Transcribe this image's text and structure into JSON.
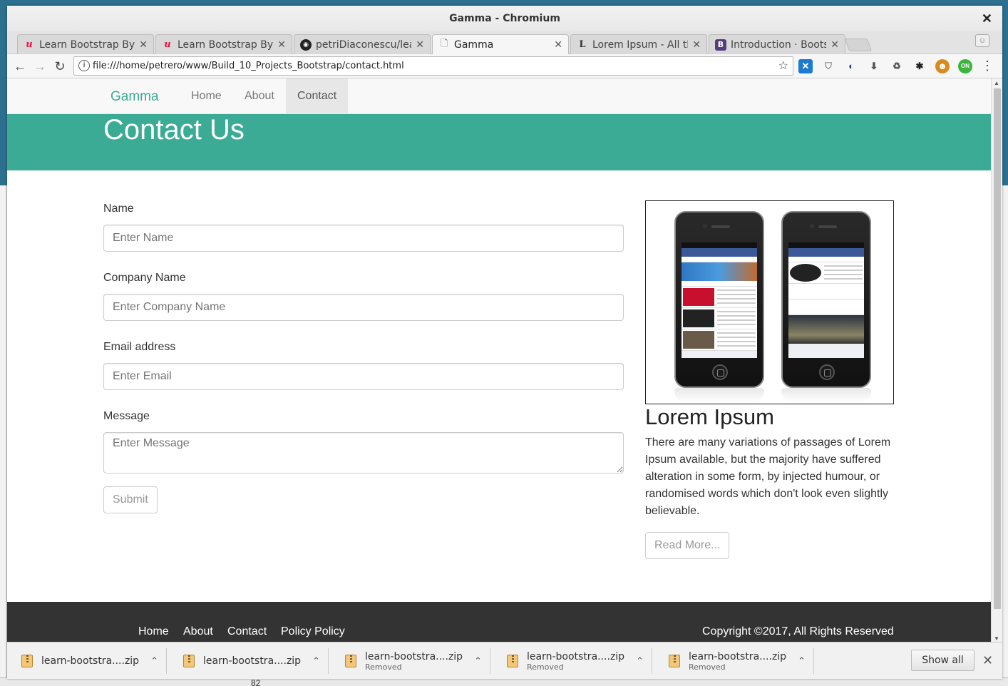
{
  "window": {
    "title": "Gamma - Chromium",
    "close_glyph": "✕"
  },
  "tabs": [
    {
      "label": "Learn Bootstrap By",
      "favicon": "udemy-icon",
      "active": false
    },
    {
      "label": "Learn Bootstrap By",
      "favicon": "udemy-icon",
      "active": false
    },
    {
      "label": "petriDiaconescu/lea",
      "favicon": "github-icon",
      "active": false
    },
    {
      "label": "Gamma",
      "favicon": "page-icon",
      "active": true
    },
    {
      "label": "Lorem Ipsum - All th",
      "favicon": "lipsum-icon",
      "active": false
    },
    {
      "label": "Introduction · Boots",
      "favicon": "bootstrap-icon",
      "active": false
    }
  ],
  "toolbar": {
    "url": "file:///home/petrero/www/Build_10_Projects_Bootstrap/contact.html"
  },
  "site": {
    "brand": "Gamma",
    "nav": [
      "Home",
      "About",
      "Contact"
    ],
    "active_nav": "Contact",
    "hero_title": "Contact Us",
    "accent_color": "#3bab95"
  },
  "form": {
    "name_label": "Name",
    "name_placeholder": "Enter Name",
    "company_label": "Company Name",
    "company_placeholder": "Enter Company Name",
    "email_label": "Email address",
    "email_placeholder": "Enter Email",
    "message_label": "Message",
    "message_placeholder": "Enter Message",
    "submit_label": "Submit"
  },
  "aside": {
    "heading": "Lorem Ipsum",
    "body": "There are many variations of passages of Lorem Ipsum available, but the majority have suffered alteration in some form, by injected humour, or randomised words which don't look even slightly believable.",
    "button_label": "Read More..."
  },
  "footer": {
    "links": [
      "Home",
      "About",
      "Contact",
      "Policy Policy"
    ],
    "copyright": "Copyright ©2017, All Rights Reserved"
  },
  "downloads": [
    {
      "filename": "learn-bootstra....zip",
      "status": ""
    },
    {
      "filename": "learn-bootstra....zip",
      "status": ""
    },
    {
      "filename": "learn-bootstra....zip",
      "status": "Removed"
    },
    {
      "filename": "learn-bootstra....zip",
      "status": "Removed"
    },
    {
      "filename": "learn-bootstra....zip",
      "status": "Removed"
    }
  ],
  "shelf": {
    "show_all_label": "Show all"
  },
  "desktop": {
    "bottom_number": "82"
  }
}
